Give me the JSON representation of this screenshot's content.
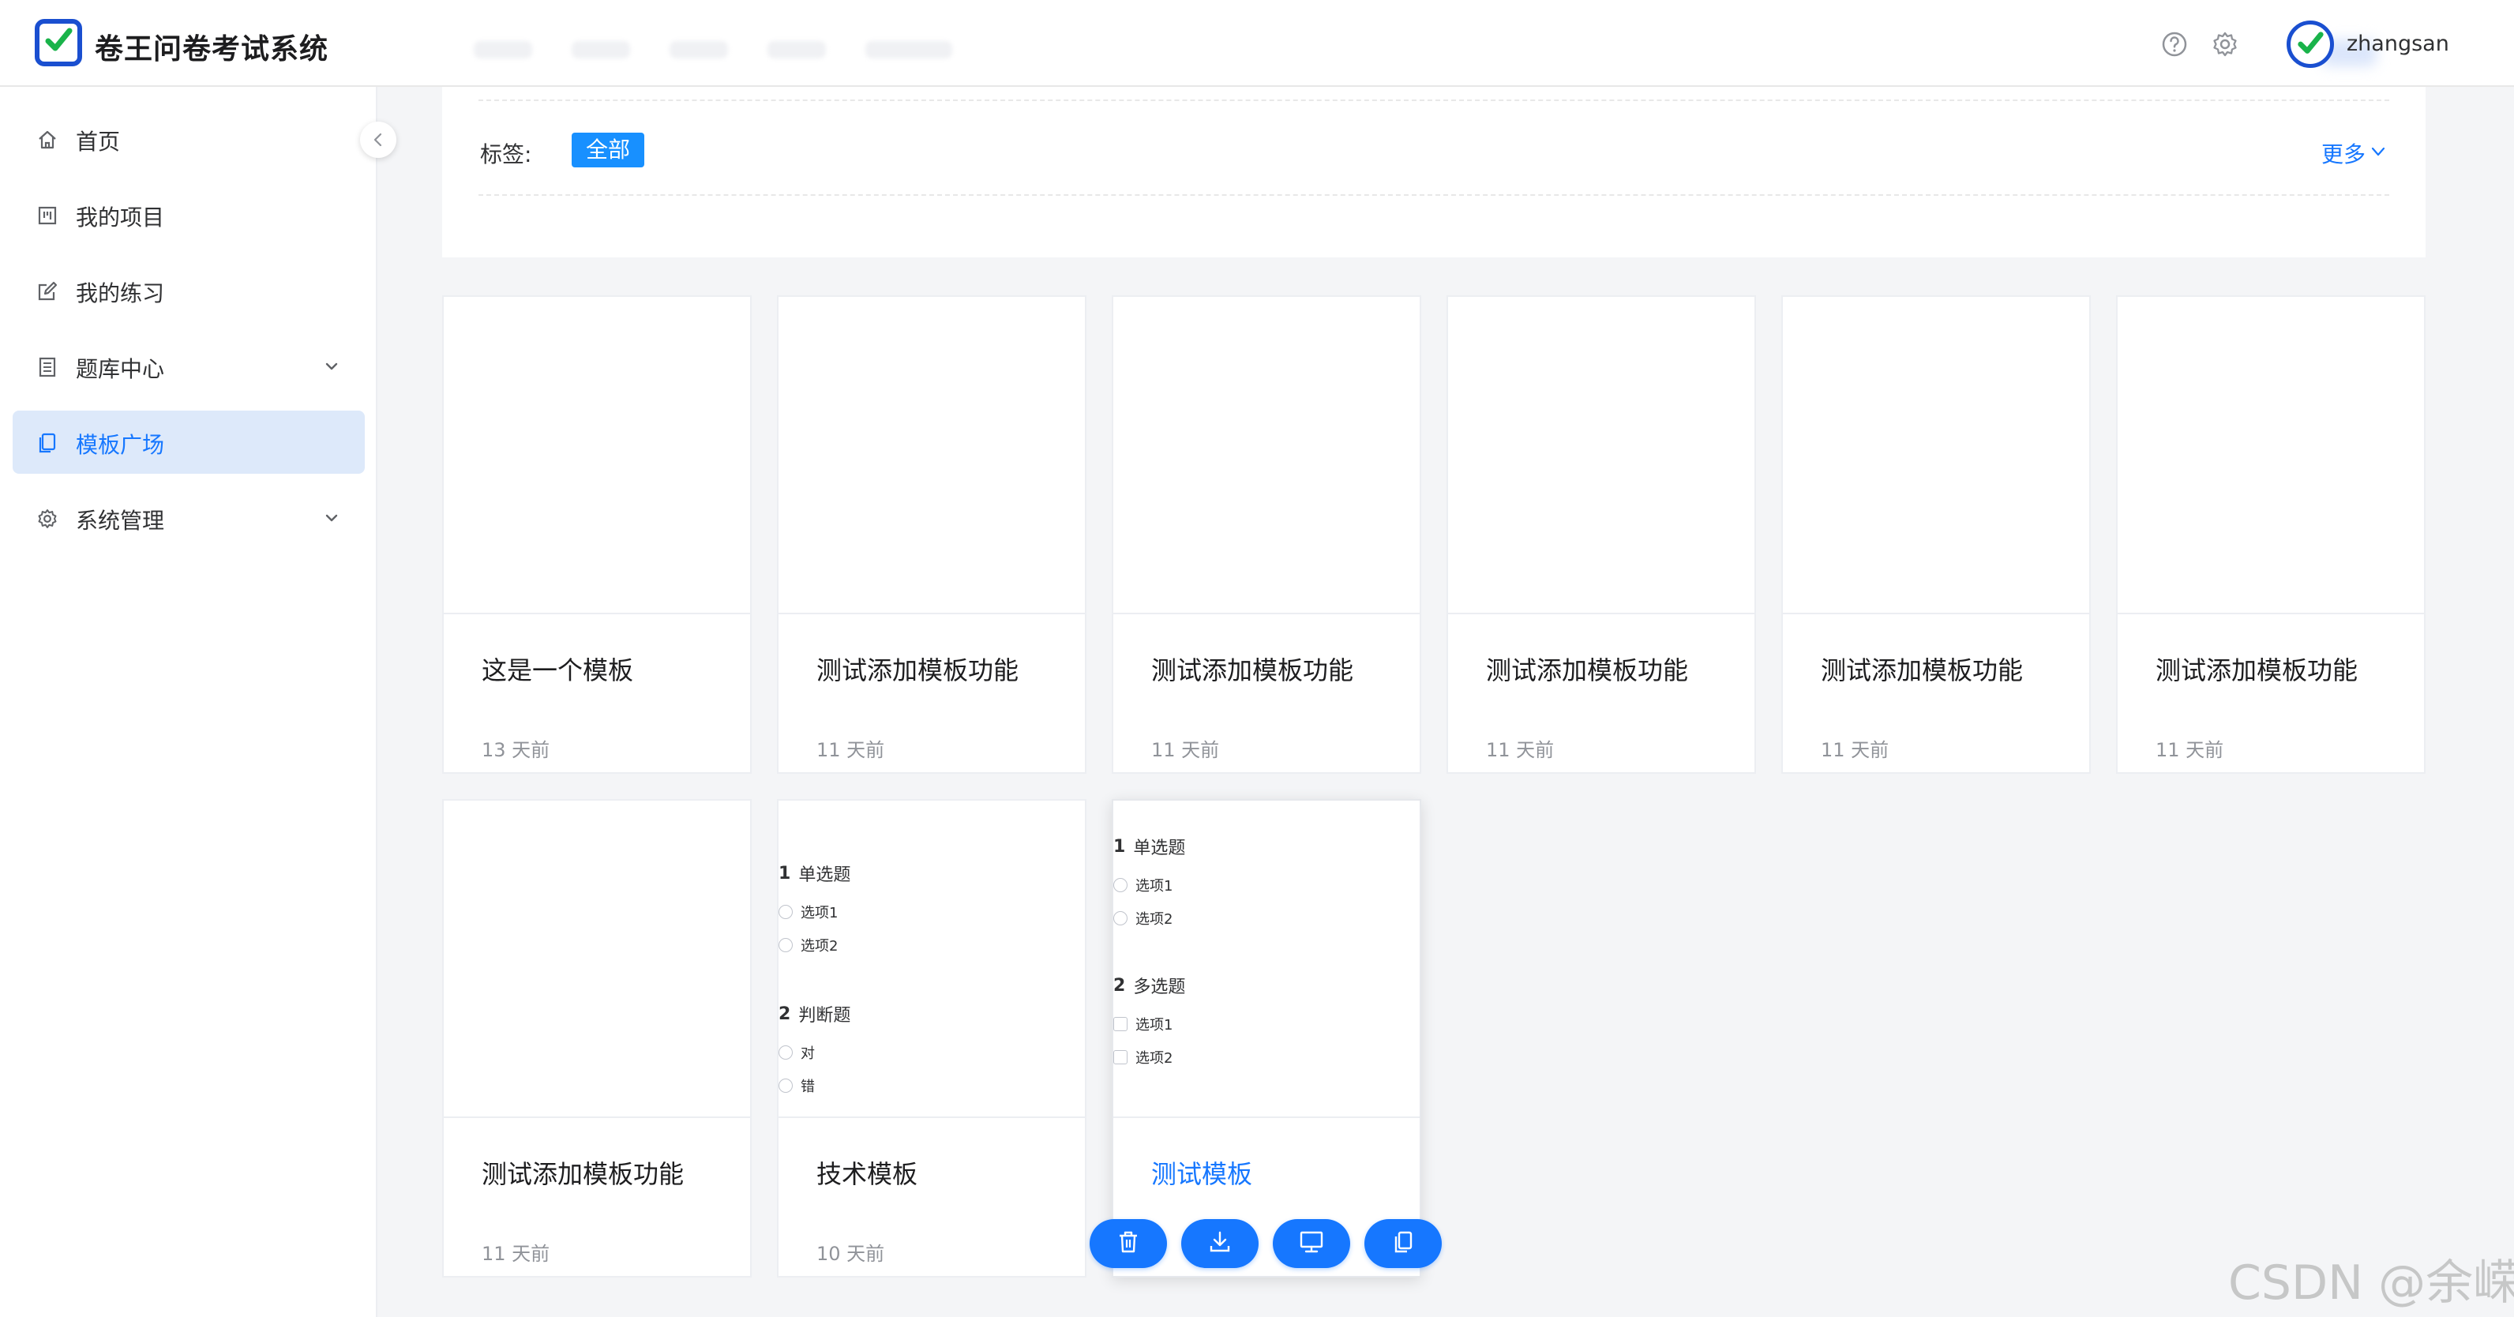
{
  "app": {
    "title": "卷王问卷考试系统",
    "accent_color": "#1677ff",
    "brand_color": "#1a4fd0"
  },
  "header": {
    "user_name": "zhangsan",
    "icons": [
      "help-icon",
      "settings-icon"
    ]
  },
  "sidebar": {
    "items": [
      {
        "label": "首页",
        "icon": "home-icon",
        "active": false,
        "expandable": false
      },
      {
        "label": "我的项目",
        "icon": "project-icon",
        "active": false,
        "expandable": false
      },
      {
        "label": "我的练习",
        "icon": "edit-icon",
        "active": false,
        "expandable": false
      },
      {
        "label": "题库中心",
        "icon": "bank-icon",
        "active": false,
        "expandable": true
      },
      {
        "label": "模板广场",
        "icon": "template-icon",
        "active": true,
        "expandable": false
      },
      {
        "label": "系统管理",
        "icon": "gear-icon",
        "active": false,
        "expandable": true
      }
    ]
  },
  "filter": {
    "label": "标签:",
    "selected_tag": "全部",
    "more_label": "更多"
  },
  "templates": [
    {
      "title": "这是一个模板",
      "time": "13 天前"
    },
    {
      "title": "测试添加模板功能",
      "time": "11 天前"
    },
    {
      "title": "测试添加模板功能",
      "time": "11 天前"
    },
    {
      "title": "测试添加模板功能",
      "time": "11 天前"
    },
    {
      "title": "测试添加模板功能",
      "time": "11 天前"
    },
    {
      "title": "测试添加模板功能",
      "time": "11 天前"
    },
    {
      "title": "测试添加模板功能",
      "time": "11 天前"
    },
    {
      "title": "技术模板",
      "time": "10 天前",
      "preview": [
        {
          "num": "1",
          "title": "单选题",
          "options": [
            "选项1",
            "选项2"
          ]
        },
        {
          "num": "2",
          "title": "判断题",
          "options": [
            "对",
            "错"
          ]
        }
      ]
    },
    {
      "title": "测试模板",
      "time": "",
      "preview": [
        {
          "num": "1",
          "title": "单选题",
          "options": [
            "选项1",
            "选项2"
          ]
        },
        {
          "num": "2",
          "title": "多选题",
          "options": [
            "选项1",
            "选项2"
          ]
        }
      ]
    }
  ],
  "card_actions": [
    "delete-icon",
    "download-icon",
    "preview-icon",
    "copy-icon"
  ],
  "watermark": "CSDN @余嵘"
}
